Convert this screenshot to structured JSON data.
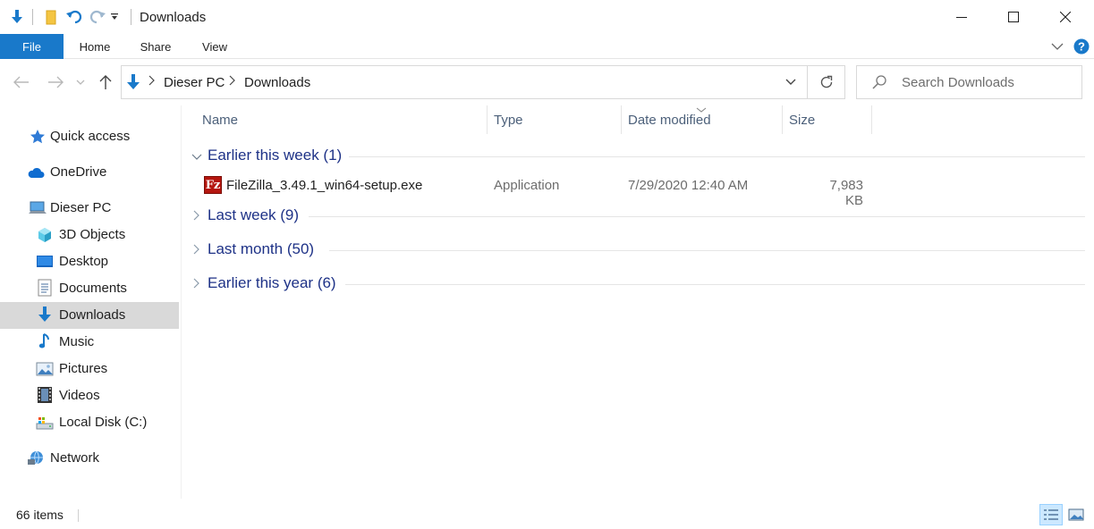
{
  "window": {
    "title": "Downloads"
  },
  "ribbon": {
    "tabs": [
      {
        "label": "File"
      },
      {
        "label": "Home"
      },
      {
        "label": "Share"
      },
      {
        "label": "View"
      }
    ]
  },
  "address": {
    "crumbs": [
      "Dieser PC",
      "Downloads"
    ]
  },
  "search": {
    "placeholder": "Search Downloads"
  },
  "sidebar": {
    "items": [
      {
        "label": "Quick access",
        "icon": "star-icon"
      },
      {
        "label": "OneDrive",
        "icon": "cloud-icon"
      },
      {
        "label": "Dieser PC",
        "icon": "computer-icon"
      },
      {
        "label": "3D Objects",
        "icon": "cube-icon"
      },
      {
        "label": "Desktop",
        "icon": "desktop-icon"
      },
      {
        "label": "Documents",
        "icon": "document-icon"
      },
      {
        "label": "Downloads",
        "icon": "download-arrow-icon",
        "selected": true
      },
      {
        "label": "Music",
        "icon": "music-note-icon"
      },
      {
        "label": "Pictures",
        "icon": "picture-icon"
      },
      {
        "label": "Videos",
        "icon": "film-icon"
      },
      {
        "label": "Local Disk (C:)",
        "icon": "drive-icon"
      },
      {
        "label": "Network",
        "icon": "network-icon"
      }
    ]
  },
  "columns": {
    "name": "Name",
    "type": "Type",
    "date": "Date modified",
    "size": "Size"
  },
  "groups": [
    {
      "label": "Earlier this week (1)",
      "expanded": true
    },
    {
      "label": "Last week (9)",
      "expanded": false
    },
    {
      "label": "Last month (50)",
      "expanded": false
    },
    {
      "label": "Earlier this year (6)",
      "expanded": false
    }
  ],
  "files": [
    {
      "name": "FileZilla_3.49.1_win64-setup.exe",
      "type": "Application",
      "date": "7/29/2020 12:40 AM",
      "size": "7,983 KB",
      "icon_letter": "Fz"
    }
  ],
  "status": {
    "count": "66 items"
  },
  "colors": {
    "accent": "#1979ca",
    "group_text": "#1e3287",
    "header_text": "#4c607a",
    "selection": "#d9d9d9"
  }
}
